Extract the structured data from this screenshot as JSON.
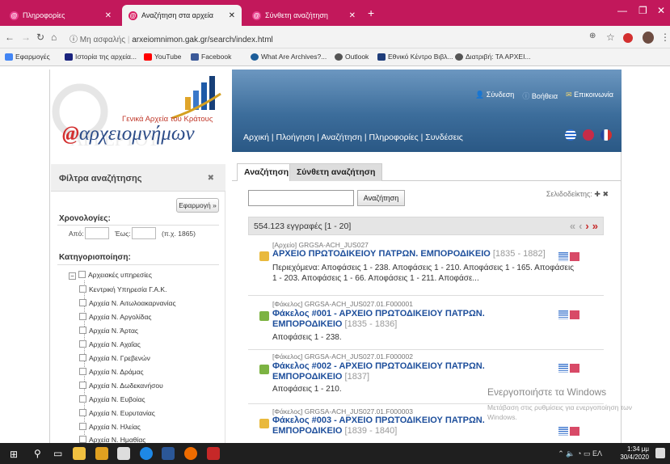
{
  "browser": {
    "tabs": [
      {
        "label": "Πληροφορίες"
      },
      {
        "label": "Αναζήτηση στα αρχεία"
      },
      {
        "label": "Σύνθετη αναζήτηση"
      }
    ],
    "url_security": "Μη ασφαλής",
    "url": "arxeiomnimon.gak.gr/search/index.html",
    "bookmarks": [
      {
        "label": "Εφαρμογές",
        "color": "#4285f4"
      },
      {
        "label": "Ιστορία της αρχεία...",
        "color": "#1a237e"
      },
      {
        "label": "YouTube",
        "color": "#ff0000"
      },
      {
        "label": "Facebook",
        "color": "#3b5998"
      },
      {
        "label": "What Are Archives?...",
        "color": "#1c5d99"
      },
      {
        "label": "Outlook",
        "color": "#555555"
      },
      {
        "label": "Εθνικό Κέντρο Βιβλ...",
        "color": "#1f3d7a"
      },
      {
        "label": "Διατριβή: ΤΑ ΑΡΧΕΙ...",
        "color": "#555555"
      }
    ]
  },
  "header": {
    "logo_subtitle": "Γενικά Αρχεία του Κράτους",
    "logo_text": "αρχειομνήμων",
    "top_links": [
      "Σύνδεση",
      "Βοήθεια",
      "Επικοινωνία"
    ],
    "nav": [
      "Αρχική",
      "Πλοήγηση",
      "Αναζήτηση",
      "Πληροφορίες",
      "Συνδέσεις"
    ]
  },
  "sidebar": {
    "title": "Φίλτρα αναζήτησης",
    "apply": "Εφαρμογή »",
    "chronology_heading": "Χρονολογίες:",
    "from_label": "Από:",
    "to_label": "Έως:",
    "example": "(π.χ. 1865)",
    "category_heading": "Κατηγοριοποίηση:",
    "root": "Αρχειακές υπηρεσίες",
    "items": [
      "Κεντρική Υπηρεσία Γ.Α.Κ.",
      "Αρχεία Ν. Αιτωλοακαρνανίας",
      "Αρχεία Ν. Αργολίδας",
      "Αρχεία Ν. Άρτας",
      "Αρχεία Ν. Αχαΐας",
      "Αρχεία Ν. Γρεβενών",
      "Αρχεία Ν. Δράμας",
      "Αρχεία Ν. Δωδεκανήσου",
      "Αρχεία Ν. Ευβοίας",
      "Αρχεία Ν. Ευρυτανίας",
      "Αρχεία Ν. Ηλείας",
      "Αρχεία Ν. Ημαθίας"
    ]
  },
  "main": {
    "tabs": [
      "Αναζήτηση",
      "Σύνθετη αναζήτηση"
    ],
    "search_button": "Αναζήτηση",
    "bookmarks_label": "Σελιδοδείκτης:",
    "result_count": "554.123 εγγραφές [1 - 20]",
    "results": [
      {
        "type": "[Αρχείο] GRGSA-ACH_JUS027",
        "title": "ΑΡΧΕΙΟ ΠΡΩΤΟΔΙΚΕΙΟΥ ΠΑΤΡΩΝ. ΕΜΠΟΡΟΔΙΚΕΙΟ",
        "date": "[1835 - 1882]",
        "desc": "Περιεχόμενα: Αποφάσεις 1 - 238. Αποφάσεις 1 - 210. Αποφάσεις 1 - 165. Αποφάσεις 1 - 203. Αποφάσεις 1 - 66. Αποφάσεις 1 - 211. Αποφάσε..."
      },
      {
        "type": "[Φάκελος] GRGSA-ACH_JUS027.01.F000001",
        "title": "Φάκελος #001 - ΑΡΧΕΙΟ ΠΡΩΤΟΔΙΚΕΙΟΥ ΠΑΤΡΩΝ. ΕΜΠΟΡΟΔΙΚΕΙΟ",
        "date": "[1835 - 1836]",
        "desc": "Αποφάσεις 1 - 238."
      },
      {
        "type": "[Φάκελος] GRGSA-ACH_JUS027.01.F000002",
        "title": "Φάκελος #002 - ΑΡΧΕΙΟ ΠΡΩΤΟΔΙΚΕΙΟΥ ΠΑΤΡΩΝ. ΕΜΠΟΡΟΔΙΚΕΙΟ",
        "date": "[1837]",
        "desc": "Αποφάσεις 1 - 210."
      },
      {
        "type": "[Φάκελος] GRGSA-ACH_JUS027.01.F000003",
        "title": "Φάκελος #003 - ΑΡΧΕΙΟ ΠΡΩΤΟΔΙΚΕΙΟΥ ΠΑΤΡΩΝ. ΕΜΠΟΡΟΔΙΚΕΙΟ",
        "date": "[1839 - 1840]",
        "desc": ""
      }
    ]
  },
  "watermark": {
    "title": "Ενεργοποιήστε τα Windows",
    "text": "Μετάβαση στις ρυθμίσεις για ενεργοποίηση των Windows."
  },
  "taskbar": {
    "time": "1:34 μμ",
    "date": "30/4/2020",
    "lang": "ΕΛ"
  },
  "colors": {
    "tabbar": "#c2185b",
    "banner": "#3c6d9b",
    "link": "#1d4e9b"
  }
}
